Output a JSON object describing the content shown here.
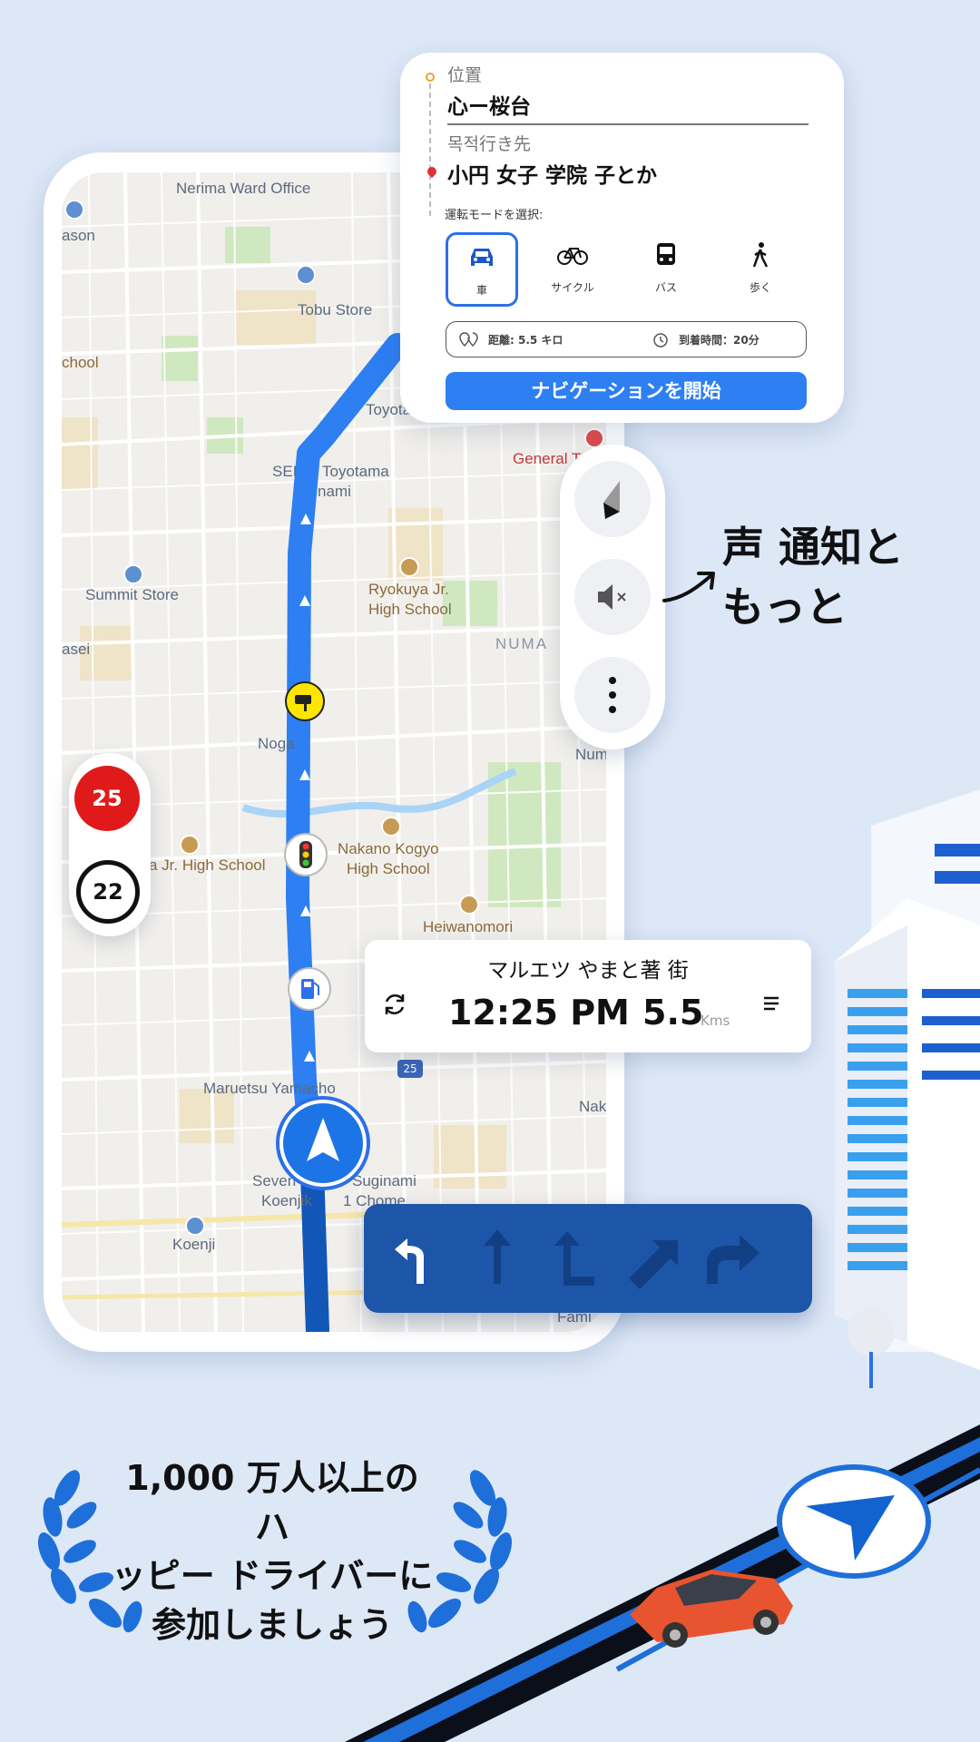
{
  "route_card": {
    "origin_label": "位置",
    "origin_value": "心ー桜台",
    "destination_label": "목적行き先",
    "destination_value": "小円 女子 学院 子とか",
    "mode_title": "運転モードを選択:",
    "modes": [
      {
        "icon": "car-icon",
        "label": "車",
        "active": true
      },
      {
        "icon": "bicycle-icon",
        "label": "サイクル",
        "active": false
      },
      {
        "icon": "bus-icon",
        "label": "バス",
        "active": false
      },
      {
        "icon": "walk-icon",
        "label": "歩く",
        "active": false
      }
    ],
    "distance_text": "距離: 5.5 キロ",
    "arrival_text": "到着時間：20分",
    "start_button": "ナビゲーションを開始"
  },
  "side_controls": {
    "icons": [
      "compass-icon",
      "mute-icon",
      "more-vertical-icon"
    ]
  },
  "voice_note": {
    "line1": "声 通知と",
    "line2": "もっと"
  },
  "speed": {
    "limit": "25",
    "current": "22"
  },
  "eta": {
    "place": "マルエツ やまと著 街",
    "time": "12:25 PM",
    "distance": "5.5",
    "unit": "Kms"
  },
  "map_labels": {
    "nerima": "Nerima Ward Office",
    "tobu": "Tobu Store",
    "ason": "ason",
    "school_left": "chool",
    "toyota_top": "Toyota",
    "general": "General T",
    "sei": "SEI",
    "toyotama": "Toyotama",
    "minami": "nami",
    "ryokuya1": "Ryokuya Jr.",
    "ryokuya2": "High School",
    "summit": "Summit Store",
    "numa": "NUMA",
    "asei": "asei",
    "noga": "Noga",
    "num": "Num",
    "jr_high": "a Jr. High School",
    "nakano1": "Nakano Kogyo",
    "nakano2": "High School",
    "heiwa": "Heiwanomori",
    "maruetsu": "Maruetsu Yamacho",
    "nak": "Nak",
    "seven1": "Seven E",
    "seven2": "Suginami",
    "koenji_chome": "Koenjik",
    "chome": "1 Chome",
    "koenji": "Koenji",
    "fami": "Fami",
    "route_badge": "25"
  },
  "tagline": {
    "line1": "1,000 万人以上のハ",
    "line2": "ッピー ドライバーに",
    "line3": "参加しましょう"
  },
  "colors": {
    "background": "#dde8f7",
    "route_blue": "#2d7ff2",
    "turn_bar": "#1d56a8",
    "speed_red": "#e01a1a",
    "laurel_blue": "#1e6fd9"
  }
}
